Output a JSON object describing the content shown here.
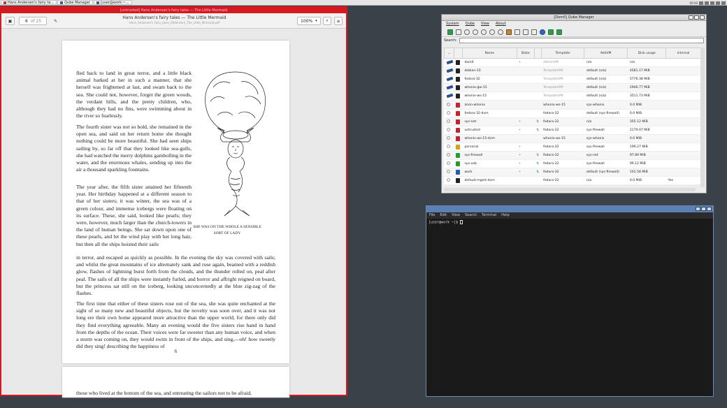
{
  "taskbar": {
    "tasks": [
      {
        "label": "Hans Andersen's fairy ta..."
      },
      {
        "label": "Qube Manager"
      },
      {
        "label": "[user@work:~..."
      }
    ],
    "clock": "00:00"
  },
  "pdf": {
    "window_title": "[untrusted] Hans Andersen's fairy tales — The Little Mermaid",
    "page_current": "6",
    "page_total": "of 25",
    "doc_title": "Hans Andersen's fairy tales — The Little Mermaid",
    "doc_path": "Hans_Andersen's_fairy_tales_(Robinson)_The_Little_Mermaid.pdf",
    "zoom": "100%",
    "para1": "fled back to land in great terror, and a little black animal barked at her in such a manner, that she herself was frightened at last, and swam back to the sea. She could not, however, forget the green woods, the verdant hills, and the pretty children, who, although they had no fins, were swimming about in the river so fearlessly.",
    "para2": "The fourth sister was not so bold, she remained in the open sea, and said on her return home she thought nothing could be more beautiful. She had seen ships sailing by, so far off that they looked like sea-gulls, she had watched the merry dolphins gambolling in the water, and the enormous whales, sending up into the air a thousand sparkling fountains.",
    "para3a": "The year after, the fifth sister attained her fifteenth year. Her birthday happened at a different season to that of her sisters; it was winter, the sea was of a green colour, and immense icebergs were floating on its surface. These, she said, looked like pearls; they were, however, much larger than the church-towers in the land of human beings. She sat down upon one of these pearls, and let the wind play with her long hair, but then all the ships hoisted their sails",
    "para3b": "in terror, and escaped as quickly as possible. In the evening the sky was covered with sails; and whilst the great mountains of ice alternately sank and rose again, beamed with a reddish glow, flashes of lightning burst forth from the clouds, and the thunder rolled on, peal after peal. The sails of all the ships were instantly furled, and horror and affright reigned on board, but the princess sat still on the iceberg, looking unconcernedly at the blue zig-zag of the flashes.",
    "para4": "The first time that either of these sisters rose out of the sea, she was quite enchanted at the sight of so many new and beautiful objects, but the novelty was soon over, and it was not long ere their own home appeared more attractive than the upper world, for there only did they find everything agreeable. Many an evening would the five sisters rise hand in hand from the depths of the ocean. Their voices were far sweeter than any human voice, and when a storm was coming on, they would swim in front of the ships, and sing,—oh! how sweetly did they sing! describing the happiness of",
    "caption": "SHE WAS ON THE WHOLE A SENSIBLE SORT OF LADY",
    "page_number": "6",
    "next_page_text": "those who lived at the bottom of the sea, and entreating the sailors not to be afraid,"
  },
  "qube_manager": {
    "title": "[Dom0] Qube Manager",
    "menu": [
      "System",
      "Qube",
      "View",
      "About"
    ],
    "search_label": "Search:",
    "columns": [
      "",
      "",
      "Name",
      "State",
      "",
      "Template",
      "NetVM",
      "Disk usage",
      "Internal"
    ],
    "rows": [
      {
        "icon": "pen",
        "lock": "#222",
        "name": "dom0",
        "state": "•",
        "upd": "",
        "template": "AdminVM",
        "tdim": true,
        "netvm": "n/a",
        "disk": "n/a",
        "internal": ""
      },
      {
        "icon": "pen",
        "lock": "#222",
        "name": "debian-10",
        "state": "",
        "upd": "",
        "template": "TemplateVM",
        "tdim": true,
        "netvm": "default (n/a)",
        "disk": "4581.17 MiB",
        "internal": ""
      },
      {
        "icon": "pen",
        "lock": "#222",
        "name": "fedora-32",
        "state": "",
        "upd": "",
        "template": "TemplateVM",
        "tdim": true,
        "netvm": "default (n/a)",
        "disk": "5776.38 MiB",
        "internal": ""
      },
      {
        "icon": "pen",
        "lock": "#222",
        "name": "whonix-gw-15",
        "state": "",
        "upd": "",
        "template": "TemplateVM",
        "tdim": true,
        "netvm": "default (n/a)",
        "disk": "2946.77 MiB",
        "internal": ""
      },
      {
        "icon": "pen",
        "lock": "#222",
        "name": "whonix-ws-15",
        "state": "",
        "upd": "",
        "template": "TemplateVM",
        "tdim": true,
        "netvm": "default (n/a)",
        "disk": "3511.73 MiB",
        "internal": ""
      },
      {
        "icon": "mag",
        "lock": "#c0262d",
        "name": "anon-whonix",
        "state": "",
        "upd": "",
        "template": "whonix-ws-15",
        "tdim": false,
        "netvm": "sys-whonix",
        "disk": "0.0 MiB",
        "internal": ""
      },
      {
        "icon": "mag",
        "lock": "#c0262d",
        "name": "fedora-32-dvm",
        "state": "",
        "upd": "",
        "template": "fedora-32",
        "tdim": false,
        "netvm": "default (sys-firewall)",
        "disk": "0.0 MiB",
        "internal": ""
      },
      {
        "icon": "mag",
        "lock": "#c0262d",
        "name": "sys-net",
        "state": "•",
        "upd": "⇅",
        "template": "fedora-32",
        "tdim": false,
        "netvm": "n/a",
        "disk": "355.12 MiB",
        "internal": ""
      },
      {
        "icon": "mag",
        "lock": "#c0262d",
        "name": "untrusted",
        "state": "•",
        "upd": "⇅",
        "template": "fedora-32",
        "tdim": false,
        "netvm": "sys-firewall",
        "disk": "2179.07 MiB",
        "internal": ""
      },
      {
        "icon": "mag",
        "lock": "#c0262d",
        "name": "whonix-ws-15-dvm",
        "state": "",
        "upd": "",
        "template": "whonix-ws-15",
        "tdim": false,
        "netvm": "sys-whonix",
        "disk": "0.0 MiB",
        "internal": ""
      },
      {
        "icon": "mag",
        "lock": "#d6a21a",
        "name": "personal",
        "state": "•",
        "upd": "",
        "template": "fedora-32",
        "tdim": false,
        "netvm": "sys-firewall",
        "disk": "199.27 MiB",
        "internal": ""
      },
      {
        "icon": "mag",
        "lock": "#2b9a2b",
        "name": "sys-firewall",
        "state": "•",
        "upd": "⇅",
        "template": "fedora-32",
        "tdim": false,
        "netvm": "sys-net",
        "disk": "97.89 MiB",
        "internal": ""
      },
      {
        "icon": "mag",
        "lock": "#2b9a2b",
        "name": "sys-usb",
        "state": "•",
        "upd": "⇅",
        "template": "fedora-32",
        "tdim": false,
        "netvm": "sys-firewall",
        "disk": "99.12 MiB",
        "internal": ""
      },
      {
        "icon": "mag",
        "lock": "#2a5db0",
        "name": "work",
        "state": "•",
        "upd": "⇅",
        "template": "fedora-32",
        "tdim": false,
        "netvm": "default (sys-firewall)",
        "disk": "101.58 MiB",
        "internal": ""
      },
      {
        "icon": "mag",
        "lock": "#222",
        "name": "default-mgmt-dvm",
        "state": "",
        "upd": "",
        "template": "fedora-32",
        "tdim": false,
        "netvm": "n/a",
        "disk": "0.0 MiB",
        "internal": "Yes"
      }
    ]
  },
  "terminal": {
    "menu": [
      "File",
      "Edit",
      "View",
      "Search",
      "Terminal",
      "Help"
    ],
    "prompt": "[user@work ~]$ "
  },
  "colors": {
    "untrusted_border": "#d7191f",
    "work_border": "#5b80b5",
    "desktop": "#3b4149"
  }
}
